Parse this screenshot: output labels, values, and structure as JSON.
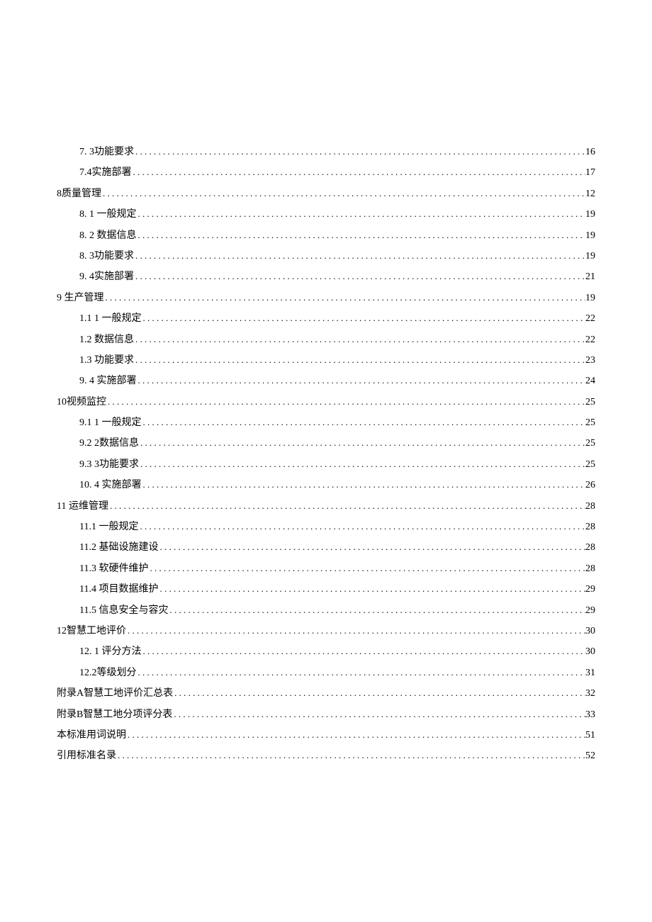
{
  "toc": [
    {
      "level": 2,
      "label": "7. 3功能要求",
      "page": "16"
    },
    {
      "level": 2,
      "label": "7.4实施部署",
      "page": "17"
    },
    {
      "level": 1,
      "label": "8质量管理",
      "page": "12"
    },
    {
      "level": 2,
      "label": "8.  1 一般规定",
      "page": "19"
    },
    {
      "level": 2,
      "label": "8.  2 数据信息",
      "page": "19"
    },
    {
      "level": 2,
      "label": "8.  3功能要求",
      "page": "19"
    },
    {
      "level": 2,
      "label": "9.  4实施部署",
      "page": "21"
    },
    {
      "level": 1,
      "label": "9 生产管理",
      "page": "19"
    },
    {
      "level": 2,
      "label": "1.1 1 一般规定",
      "page": "22"
    },
    {
      "level": 2,
      "label": "1.2    数据信息",
      "page": "22"
    },
    {
      "level": 2,
      "label": "1.3    功能要求",
      "page": "23"
    },
    {
      "level": 2,
      "label": "9.  4 实施部署",
      "page": "24"
    },
    {
      "level": 1,
      "label": "10视频监控",
      "page": "25"
    },
    {
      "level": 2,
      "label": "9.1  1 一般规定",
      "page": "25"
    },
    {
      "level": 2,
      "label": "9.2  2数据信息",
      "page": "25"
    },
    {
      "level": 2,
      "label": "9.3  3功能要求",
      "page": "25"
    },
    {
      "level": 2,
      "label": "10.  4 实施部署",
      "page": "26"
    },
    {
      "level": 1,
      "label": "11 运维管理",
      "page": "28"
    },
    {
      "level": 2,
      "label": "11.1   一般规定",
      "page": "28"
    },
    {
      "level": 2,
      "label": "11.2   基础设施建设",
      "page": "28"
    },
    {
      "level": 2,
      "label": "11.3   软硬件维护",
      "page": "28"
    },
    {
      "level": 2,
      "label": "11.4   项目数据维护",
      "page": "29"
    },
    {
      "level": 2,
      "label": "11.5   信息安全与容灾",
      "page": "29"
    },
    {
      "level": 1,
      "label": "12智慧工地评价",
      "page": "30"
    },
    {
      "level": 2,
      "label": "12. 1 评分方法",
      "page": "30"
    },
    {
      "level": 2,
      "label": "12.2等级划分",
      "page": "31"
    },
    {
      "level": 1,
      "label": "附录A智慧工地评价汇总表",
      "page": "32"
    },
    {
      "level": 1,
      "label": "附录B智慧工地分项评分表",
      "page": "33"
    },
    {
      "level": 1,
      "label": "本标准用词说明",
      "page": "51"
    },
    {
      "level": 1,
      "label": "引用标准名录",
      "page": "52"
    }
  ]
}
